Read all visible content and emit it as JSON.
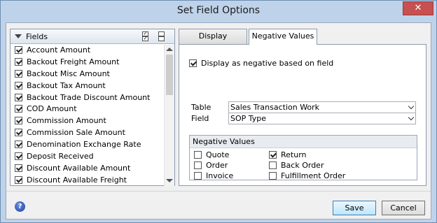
{
  "window": {
    "title": "Set Field Options"
  },
  "fields": {
    "header_label": "Fields",
    "items": [
      {
        "label": "Account Amount",
        "checked": true
      },
      {
        "label": "Backout Freight Amount",
        "checked": true
      },
      {
        "label": "Backout Misc Amount",
        "checked": true
      },
      {
        "label": "Backout Tax Amount",
        "checked": true
      },
      {
        "label": "Backout Trade Discount Amount",
        "checked": true
      },
      {
        "label": "COD Amount",
        "checked": true
      },
      {
        "label": "Commission Amount",
        "checked": true
      },
      {
        "label": "Commission Sale Amount",
        "checked": true
      },
      {
        "label": "Denomination Exchange Rate",
        "checked": true
      },
      {
        "label": "Deposit Received",
        "checked": true
      },
      {
        "label": "Discount Available Amount",
        "checked": true
      },
      {
        "label": "Discount Available Freight",
        "checked": true
      }
    ]
  },
  "tabs": [
    {
      "label": "Display",
      "active": false
    },
    {
      "label": "Negative Values",
      "active": true
    }
  ],
  "negative_tab": {
    "display_as_negative_label": "Display as negative based on field",
    "display_as_negative_checked": true,
    "table_label": "Table",
    "table_value": "Sales Transaction Work",
    "field_label": "Field",
    "field_value": "SOP Type",
    "group_title": "Negative Values",
    "options": [
      {
        "label": "Quote",
        "checked": false
      },
      {
        "label": "Order",
        "checked": false
      },
      {
        "label": "Invoice",
        "checked": false
      },
      {
        "label": "Return",
        "checked": true
      },
      {
        "label": "Back Order",
        "checked": false
      },
      {
        "label": "Fulfillment Order",
        "checked": false
      }
    ]
  },
  "buttons": {
    "save": "Save",
    "cancel": "Cancel"
  }
}
